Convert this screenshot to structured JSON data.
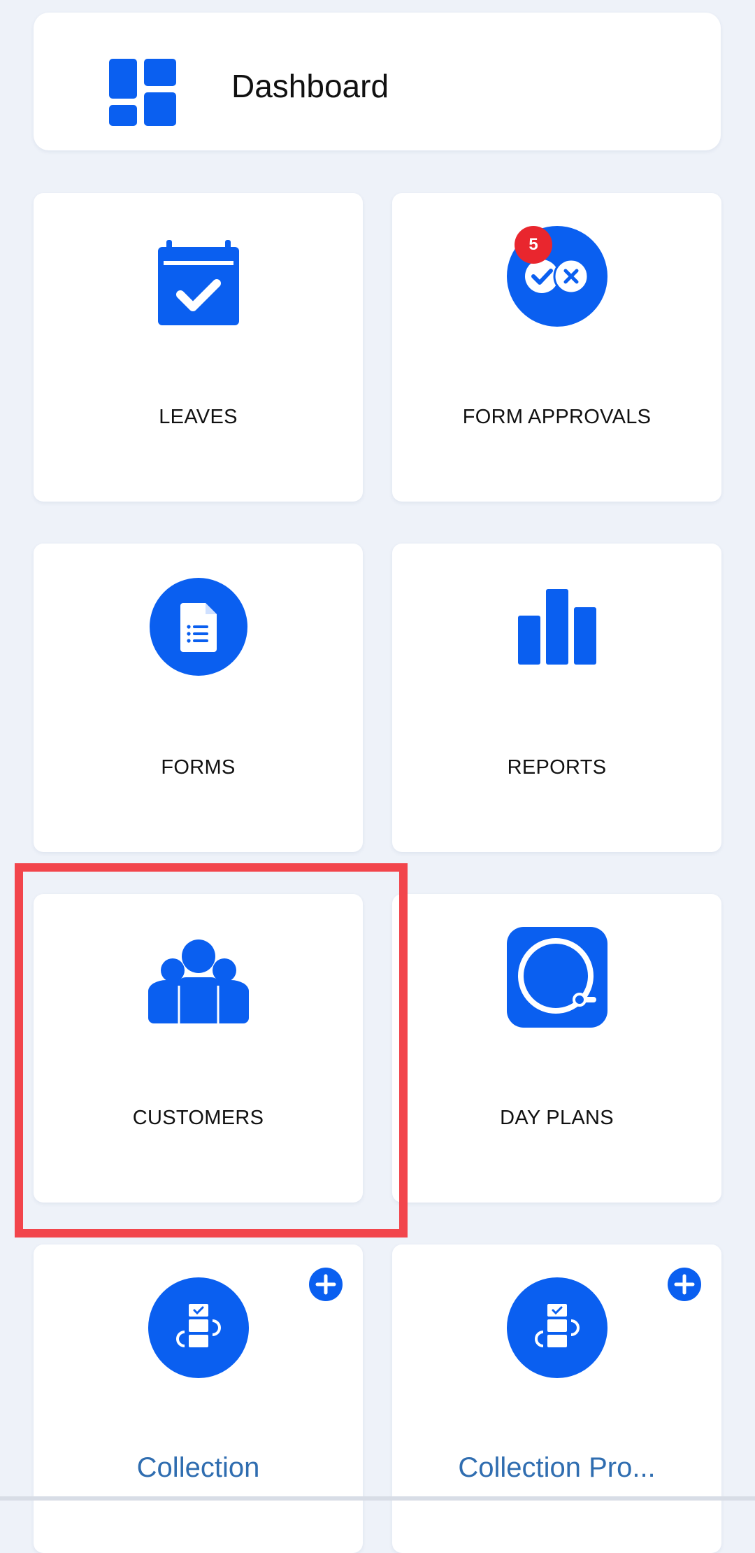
{
  "header": {
    "title": "Dashboard"
  },
  "tiles": {
    "leaves": {
      "label": "LEAVES"
    },
    "form_approvals": {
      "label": "FORM APPROVALS",
      "badge": "5"
    },
    "forms": {
      "label": "FORMS"
    },
    "reports": {
      "label": "REPORTS"
    },
    "customers": {
      "label": "CUSTOMERS"
    },
    "day_plans": {
      "label": "DAY PLANS"
    },
    "collection": {
      "label": "Collection"
    },
    "collection_pro": {
      "label": "Collection Pro..."
    }
  },
  "colors": {
    "accent": "#0a5ff0",
    "badge": "#e9262e",
    "highlight": "#f2454c",
    "link_text": "#2f6db0",
    "background": "#eef2f9"
  },
  "icons": {
    "header": "dashboard-grid-icon",
    "leaves": "calendar-check-icon",
    "form_approvals": "approve-reject-icon",
    "forms": "document-icon",
    "reports": "bar-chart-icon",
    "customers": "people-group-icon",
    "day_plans": "tape-measure-icon",
    "collection": "workflow-icon",
    "add": "plus-circle-icon"
  }
}
